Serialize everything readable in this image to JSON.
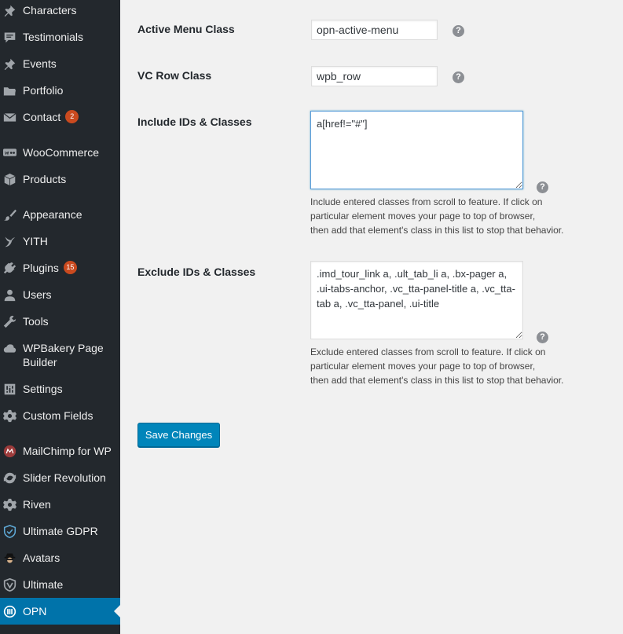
{
  "sidebar": {
    "items": [
      {
        "label": "Characters",
        "icon": "pushpin-icon"
      },
      {
        "label": "Testimonials",
        "icon": "testimonial-icon"
      },
      {
        "label": "Events",
        "icon": "pushpin-icon"
      },
      {
        "label": "Portfolio",
        "icon": "folder-icon"
      },
      {
        "label": "Contact",
        "icon": "email-icon",
        "badge": "2"
      },
      {
        "label": "WooCommerce",
        "icon": "woocommerce-icon"
      },
      {
        "label": "Products",
        "icon": "box-icon"
      },
      {
        "label": "Appearance",
        "icon": "paintbrush-icon"
      },
      {
        "label": "YITH",
        "icon": "yith-icon"
      },
      {
        "label": "Plugins",
        "icon": "plugin-icon",
        "badge": "15"
      },
      {
        "label": "Users",
        "icon": "user-icon"
      },
      {
        "label": "Tools",
        "icon": "wrench-icon"
      },
      {
        "label": "WPBakery Page Builder",
        "icon": "cloud-icon"
      },
      {
        "label": "Settings",
        "icon": "settings-sliders-icon"
      },
      {
        "label": "Custom Fields",
        "icon": "gear-icon"
      },
      {
        "label": "MailChimp for WP",
        "icon": "mailchimp-icon"
      },
      {
        "label": "Slider Revolution",
        "icon": "refresh-icon"
      },
      {
        "label": "Riven",
        "icon": "gear-icon"
      },
      {
        "label": "Ultimate GDPR",
        "icon": "shield-check-icon"
      },
      {
        "label": "Avatars",
        "icon": "spy-avatar-icon"
      },
      {
        "label": "Ultimate",
        "icon": "shield-v-icon"
      },
      {
        "label": "OPN",
        "icon": "opn-icon",
        "active": true
      }
    ]
  },
  "form": {
    "active_menu_class": {
      "label": "Active Menu Class",
      "value": "opn-active-menu"
    },
    "vc_row_class": {
      "label": "VC Row Class",
      "value": "wpb_row"
    },
    "include": {
      "label": "Include IDs & Classes",
      "value": "a[href!=\"#\"]",
      "desc_1": "Include entered classes from scroll to feature. If click on",
      "desc_2": "particular element moves your page to top of browser,",
      "desc_3": "then add that element's class in this list to stop that behavior."
    },
    "exclude": {
      "label": "Exclude IDs & Classes",
      "value": ".imd_tour_link a, .ult_tab_li a, .bx-pager a, .ui-tabs-anchor, .vc_tta-panel-title a, .vc_tta-tab a, .vc_tta-panel, .ui-title",
      "desc_1": "Exclude entered classes from scroll to feature. If click on",
      "desc_2": "particular element moves your page to top of browser,",
      "desc_3": "then add that element's class in this list to stop that behavior."
    },
    "help_glyph": "?",
    "save_label": "Save Changes"
  },
  "colors": {
    "sidebar_bg": "#23282d",
    "active_bg": "#0073aa",
    "badge_bg": "#ca4a1f",
    "button_bg": "#0085ba"
  }
}
